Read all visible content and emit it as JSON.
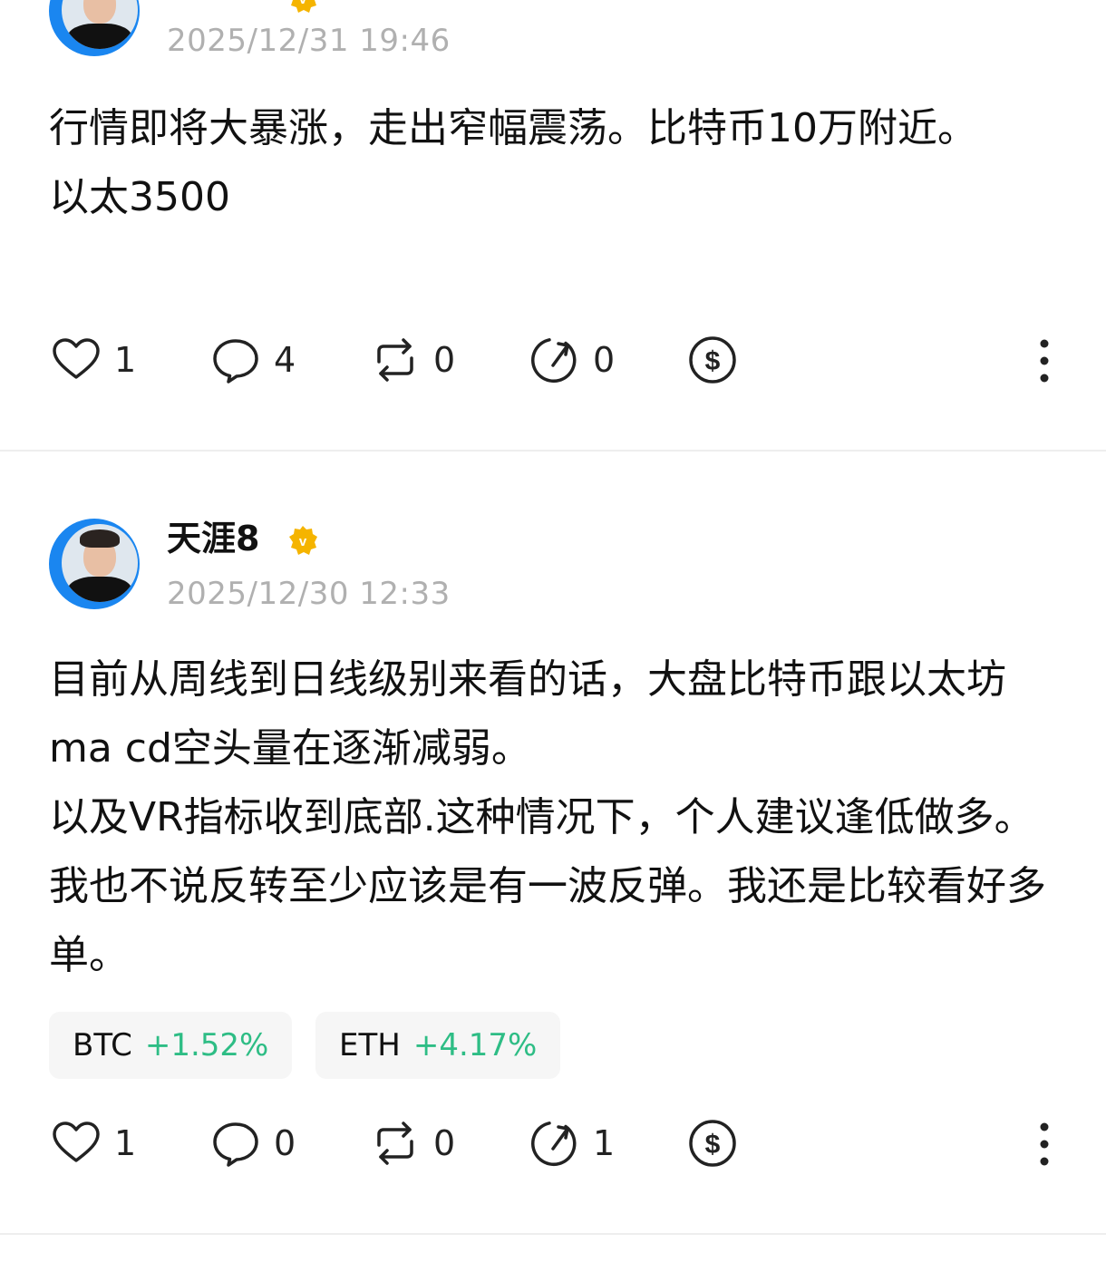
{
  "posts": [
    {
      "username": "",
      "timestamp": "2025/12/31 19:46",
      "content": [
        "行情即将大暴涨，走出窄幅震荡。比特币10万附近。",
        "以太3500"
      ],
      "tags": [],
      "actions": {
        "likes": "1",
        "comments": "4",
        "reposts": "0",
        "shares": "0",
        "tip_icon": "dollar-icon"
      }
    },
    {
      "username": "天涯8",
      "verified": true,
      "timestamp": "2025/12/30 12:33",
      "content": [
        "目前从周线到日线级别来看的话，大盘比特币跟以太坊ma cd空头量在逐渐减弱。",
        "以及VR指标收到底部.这种情况下，个人建议逢低做多。我也不说反转至少应该是有一波反弹。我还是比较看好多单。"
      ],
      "tags": [
        {
          "symbol": "BTC",
          "change": "+1.52%"
        },
        {
          "symbol": "ETH",
          "change": "+4.17%"
        }
      ],
      "actions": {
        "likes": "1",
        "comments": "0",
        "reposts": "0",
        "shares": "1",
        "tip_icon": "dollar-icon"
      }
    }
  ],
  "colors": {
    "avatar_ring": "#1a86f0",
    "verified_badge": "#f5b400",
    "positive_change": "#2ebd85",
    "timestamp": "#b0b0b0",
    "divider": "#eeeeee",
    "tag_background": "#f6f6f6"
  }
}
